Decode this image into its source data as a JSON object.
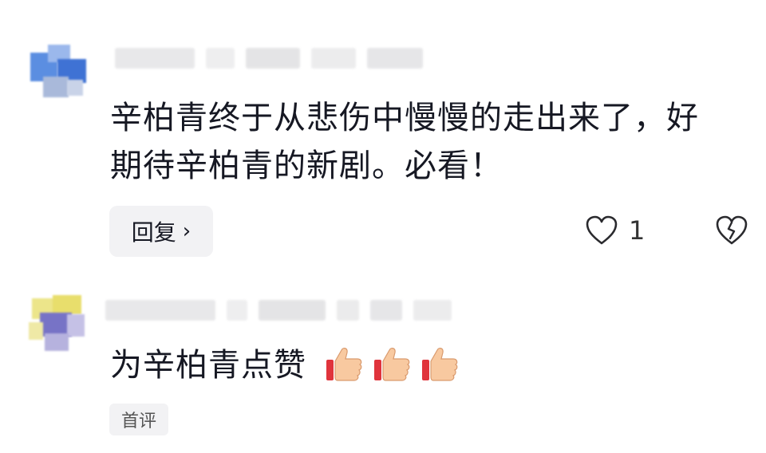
{
  "comments": [
    {
      "avatar_colors": [
        "#5a8de0",
        "#3d74d6",
        "#89aeea",
        "#b9c9e8"
      ],
      "text_line1": "辛柏青终于从悲伤中慢慢的走出来了，好",
      "text_line2": "期待辛柏青的新剧。必看！",
      "reply_label": "回复",
      "reply_chevron": "›",
      "like_count": "1",
      "icons": [
        "heart-icon",
        "broken-heart-icon"
      ]
    },
    {
      "avatar_colors": [
        "#e6de6a",
        "#7a76c8",
        "#b6b0e0",
        "#f0e9a8"
      ],
      "text": "为辛柏青点赞",
      "emoji": [
        "👍",
        "👍",
        "👍"
      ],
      "tag_label": "首评"
    }
  ]
}
